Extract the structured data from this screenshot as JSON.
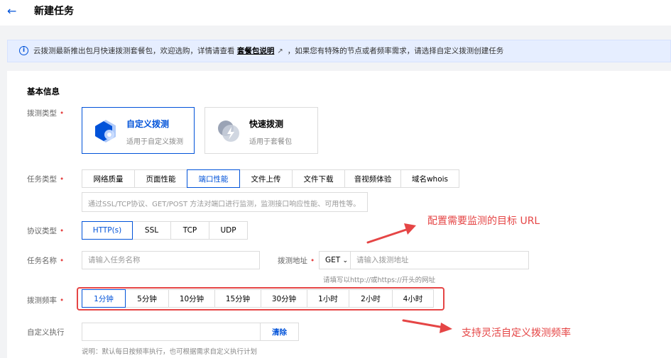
{
  "header": {
    "back_icon": "arrow-left-icon",
    "title": "新建任务"
  },
  "notice": {
    "text_before": "云拨测最新推出包月快速拨测套餐包，欢迎选购，详情请查看",
    "link": "套餐包说明",
    "text_after": "，如果您有特殊的节点或者频率需求，请选择自定义拨测创建任务"
  },
  "form": {
    "section_title": "基本信息",
    "probe_type": {
      "label": "拨测类型",
      "options": [
        {
          "title": "自定义拨测",
          "subtitle": "适用于自定义拨测",
          "active": true
        },
        {
          "title": "快速拨测",
          "subtitle": "适用于套餐包",
          "active": false
        }
      ]
    },
    "task_type": {
      "label": "任务类型",
      "options": [
        "网络质量",
        "页面性能",
        "端口性能",
        "文件上传",
        "文件下载",
        "音视频体验",
        "域名whois"
      ],
      "selected": "端口性能",
      "description": "通过SSL/TCP协议、GET/POST 方法对端口进行监测，监测接口响应性能、可用性等。"
    },
    "protocol": {
      "label": "协议类型",
      "options": [
        "HTTP(s)",
        "SSL",
        "TCP",
        "UDP"
      ],
      "selected": "HTTP(s)"
    },
    "task_name": {
      "label": "任务名称",
      "placeholder": "请输入任务名称"
    },
    "address": {
      "label": "拨测地址",
      "method": "GET",
      "placeholder": "请输入拨测地址",
      "hint": "请填写以http://或https://开头的网址"
    },
    "frequency": {
      "label": "拨测频率",
      "options": [
        "1分钟",
        "5分钟",
        "10分钟",
        "15分钟",
        "30分钟",
        "1小时",
        "2小时",
        "4小时"
      ],
      "selected": "1分钟"
    },
    "custom_exec": {
      "label": "自定义执行",
      "clear_label": "清除",
      "note": "说明：默认每日按频率执行，也可根据需求自定义执行计划"
    }
  },
  "annotations": {
    "url_note": "配置需要监测的目标 URL",
    "freq_note": "支持灵活自定义拨测频率"
  },
  "colors": {
    "primary": "#0052d9",
    "required": "#e54545",
    "annotation": "#e54545"
  }
}
